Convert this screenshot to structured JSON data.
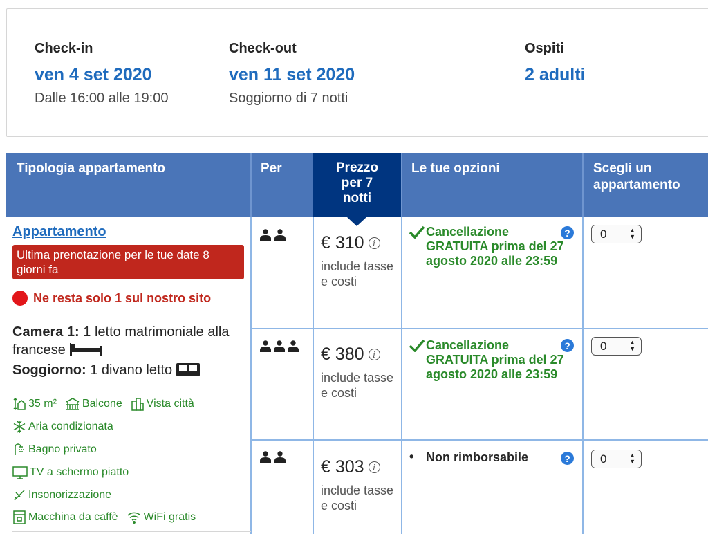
{
  "booking_summary": {
    "checkin": {
      "label": "Check-in",
      "date": "ven 4 set 2020",
      "sub": "Dalle 16:00 alle 19:00"
    },
    "checkout": {
      "label": "Check-out",
      "date": "ven 11 set 2020",
      "sub": "Soggiorno di 7 notti"
    },
    "guests": {
      "label": "Ospiti",
      "value": "2 adulti"
    }
  },
  "table": {
    "headers": {
      "room_type": "Tipologia appartamento",
      "per": "Per",
      "price_line1": "Prezzo",
      "price_line2": "per 7",
      "price_line3": "notti",
      "options": "Le tue opzioni",
      "choose_line1": "Scegli un",
      "choose_line2": "appartamento"
    },
    "room": {
      "name": "Appartamento",
      "badge": "Ultima prenotazione per le tue date 8 giorni fa",
      "only_left": "Ne resta solo 1 sul nostro sito",
      "bed1_label": "Camera 1:",
      "bed1_text": "1 letto matrimoniale alla francese",
      "bed2_label": "Soggiorno:",
      "bed2_text": "1 divano letto",
      "facilities": [
        {
          "icon": "size-icon",
          "label": "35 m²"
        },
        {
          "icon": "balcony-icon",
          "label": "Balcone"
        },
        {
          "icon": "city-view-icon",
          "label": "Vista città"
        },
        {
          "icon": "snowflake-icon",
          "label": "Aria condizionata"
        },
        {
          "icon": "shower-icon",
          "label": "Bagno privato"
        },
        {
          "icon": "tv-icon",
          "label": "TV a schermo piatto"
        },
        {
          "icon": "soundproof-icon",
          "label": "Insonorizzazione"
        },
        {
          "icon": "coffee-machine-icon",
          "label": "Macchina da caffè"
        },
        {
          "icon": "wifi-icon",
          "label": "WiFi gratis"
        }
      ]
    },
    "rows": [
      {
        "persons": 2,
        "price": "€ 310",
        "price_note": "include tasse e costi",
        "option": "Cancellazione GRATUITA prima del 27 agosto 2020 alle 23:59",
        "option_type": "free-cancel",
        "select_value": "0"
      },
      {
        "persons": 3,
        "price": "€ 380",
        "price_note": "include tasse e costi",
        "option": "Cancellazione GRATUITA prima del 27 agosto 2020 alle 23:59",
        "option_type": "free-cancel",
        "select_value": "0"
      },
      {
        "persons": 2,
        "price": "€ 303",
        "price_note": "include tasse e costi",
        "option": "Non rimborsabile",
        "option_type": "non-refundable",
        "select_value": "0"
      }
    ],
    "info_glyph": "i",
    "help_glyph": "?"
  },
  "colors": {
    "header_blue": "#4a75b8",
    "price_header_navy": "#003580",
    "link_blue": "#1f6bbd",
    "alert_red": "#c0271d",
    "green": "#2a8a2a",
    "cell_border": "#8fb7e6"
  }
}
